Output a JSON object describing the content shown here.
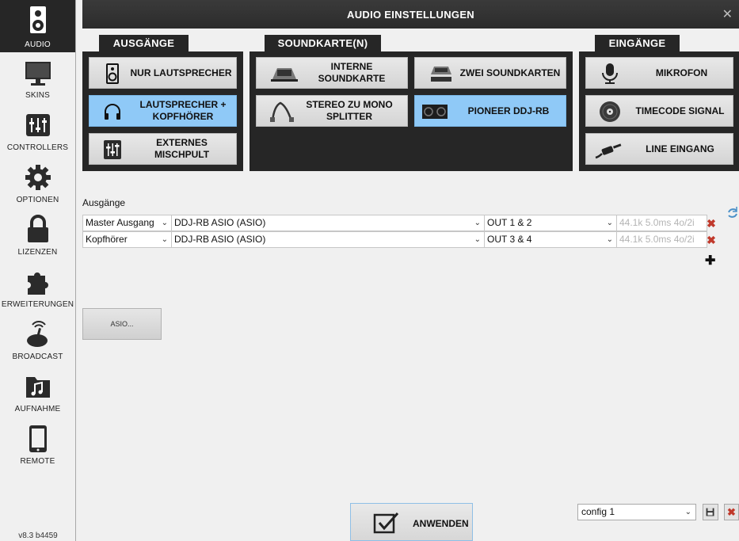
{
  "window": {
    "title": "AUDIO EINSTELLUNGEN",
    "close_glyph": "✕"
  },
  "sidebar": {
    "items": [
      {
        "label": "AUDIO",
        "icon": "speaker-icon",
        "active": true
      },
      {
        "label": "SKINS",
        "icon": "monitor-icon"
      },
      {
        "label": "CONTROLLERS",
        "icon": "mixer-sliders-icon"
      },
      {
        "label": "OPTIONEN",
        "icon": "gear-icon"
      },
      {
        "label": "LIZENZEN",
        "icon": "lock-icon"
      },
      {
        "label": "ERWEITERUNGEN",
        "icon": "puzzle-icon"
      },
      {
        "label": "BROADCAST",
        "icon": "broadcast-icon"
      },
      {
        "label": "AUFNAHME",
        "icon": "music-folder-icon"
      },
      {
        "label": "REMOTE",
        "icon": "tablet-icon"
      }
    ],
    "version": "v8.3 b4459"
  },
  "sections": {
    "outputs": {
      "tab": "AUSGÄNGE",
      "buttons": [
        {
          "label": "NUR LAUTSPRECHER",
          "icon": "speaker-icon"
        },
        {
          "label": "LAUTSPRECHER + KOPFHÖRER",
          "icon": "headphones-icon",
          "selected": true
        },
        {
          "label": "EXTERNES MISCHPULT",
          "icon": "mixer-sliders-icon"
        }
      ]
    },
    "soundcards": {
      "tab": "SOUNDKARTE(N)",
      "buttons": [
        {
          "label": "INTERNE SOUNDKARTE",
          "icon": "dj-controller-icon"
        },
        {
          "label": "ZWEI SOUNDKARTEN",
          "icon": "dual-controller-icon"
        },
        {
          "label": "STEREO ZU MONO SPLITTER",
          "icon": "splitter-cable-icon"
        },
        {
          "label": "PIONEER DDJ-RB",
          "icon": "pioneer-controller-icon",
          "selected": true
        }
      ]
    },
    "inputs": {
      "tab": "EINGÄNGE",
      "buttons": [
        {
          "label": "MIKROFON",
          "icon": "microphone-icon"
        },
        {
          "label": "TIMECODE SIGNAL",
          "icon": "vinyl-icon"
        },
        {
          "label": "LINE EINGANG",
          "icon": "cable-jack-icon"
        }
      ]
    }
  },
  "outputs_table": {
    "label": "Ausgänge",
    "rows": [
      {
        "type": "Master Ausgang",
        "device": "DDJ-RB ASIO (ASIO)",
        "channels": "OUT 1 & 2",
        "info": "44.1k 5.0ms 4o/2i"
      },
      {
        "type": "Kopfhörer",
        "device": "DDJ-RB ASIO (ASIO)",
        "channels": "OUT 3 & 4",
        "info": "44.1k 5.0ms 4o/2i"
      }
    ],
    "delete_glyph": "✖",
    "add_glyph": "✚"
  },
  "asio_button": {
    "label": "ASIO..."
  },
  "footer": {
    "apply_label": "ANWENDEN",
    "config_value": "config 1",
    "config_delete_glyph": "✖"
  },
  "colors": {
    "selected": "#8fc9f7",
    "panel": "#262626",
    "delete": "#c0392b"
  }
}
